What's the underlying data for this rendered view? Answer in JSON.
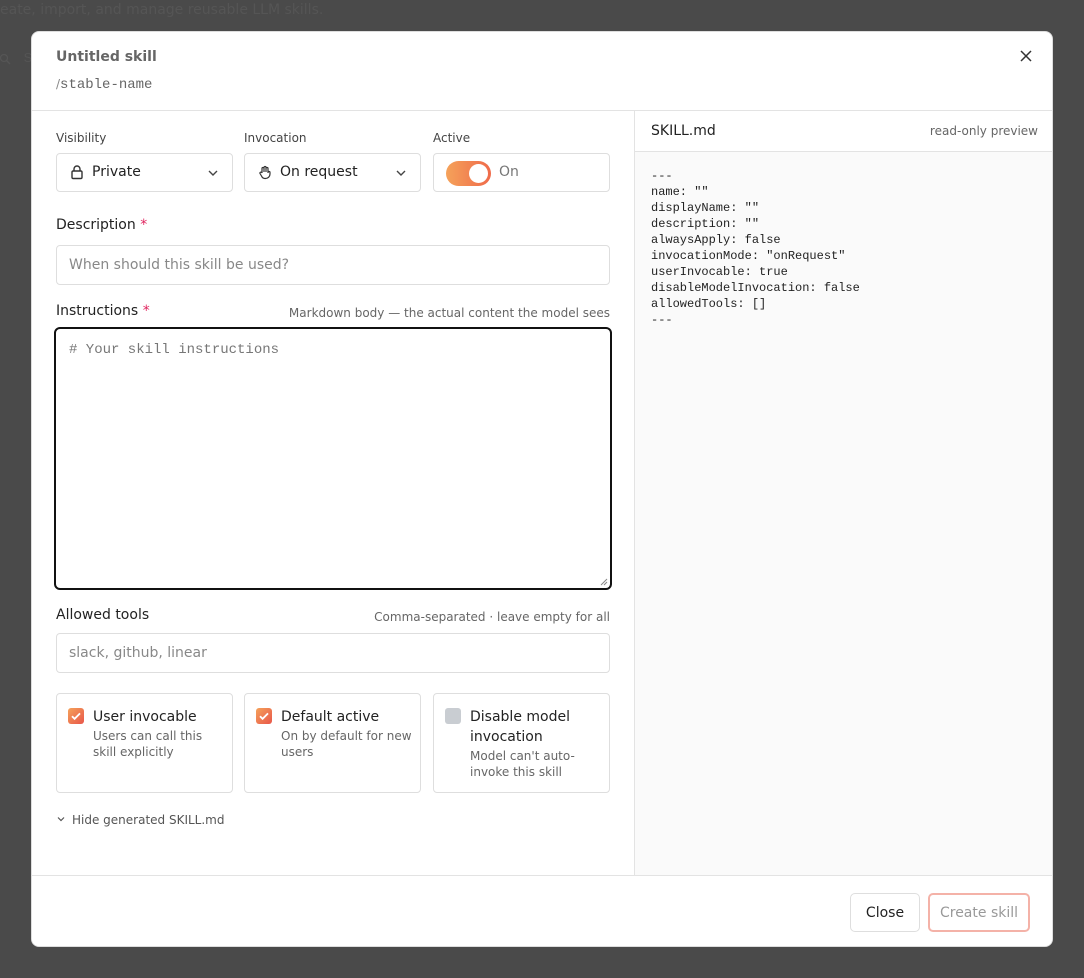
{
  "backdrop": {
    "subtitle": "eate, import, and manage reusable LLM skills.",
    "search_fragment": "S"
  },
  "header": {
    "title": "Untitled skill",
    "slug_prefix": "/",
    "slug": "stable-name",
    "close_icon": "close-icon"
  },
  "form": {
    "visibility": {
      "label": "Visibility",
      "value": "Private",
      "icon": "lock-icon"
    },
    "invocation": {
      "label": "Invocation",
      "value": "On request",
      "icon": "hand-icon"
    },
    "active": {
      "label": "Active",
      "state_text": "On",
      "enabled": true
    },
    "description": {
      "label": "Description",
      "required_mark": "*",
      "placeholder": "When should this skill be used?"
    },
    "instructions": {
      "label": "Instructions",
      "required_mark": "*",
      "hint": "Markdown body — the actual content the model sees",
      "placeholder": "# Your skill instructions"
    },
    "allowed_tools": {
      "label": "Allowed tools",
      "hint": "Comma-separated · leave empty for all",
      "placeholder": "slack, github, linear"
    },
    "options": [
      {
        "title": "User invocable",
        "desc": "Users can call this skill explicitly",
        "checked": true
      },
      {
        "title": "Default active",
        "desc": "On by default for new users",
        "checked": true
      },
      {
        "title": "Disable model invocation",
        "desc": "Model can't auto-invoke this skill",
        "checked": false
      }
    ],
    "toggle_preview_label": "Hide generated SKILL.md"
  },
  "preview": {
    "title": "SKILL.md",
    "note": "read-only preview",
    "code": "---\nname: \"\"\ndisplayName: \"\"\ndescription: \"\"\nalwaysApply: false\ninvocationMode: \"onRequest\"\nuserInvocable: true\ndisableModelInvocation: false\nallowedTools: []\n---"
  },
  "footer": {
    "close_label": "Close",
    "create_label": "Create skill"
  },
  "colors": {
    "accent_start": "#f5a25a",
    "accent_end": "#ef6a4a",
    "required": "#e0245e"
  }
}
